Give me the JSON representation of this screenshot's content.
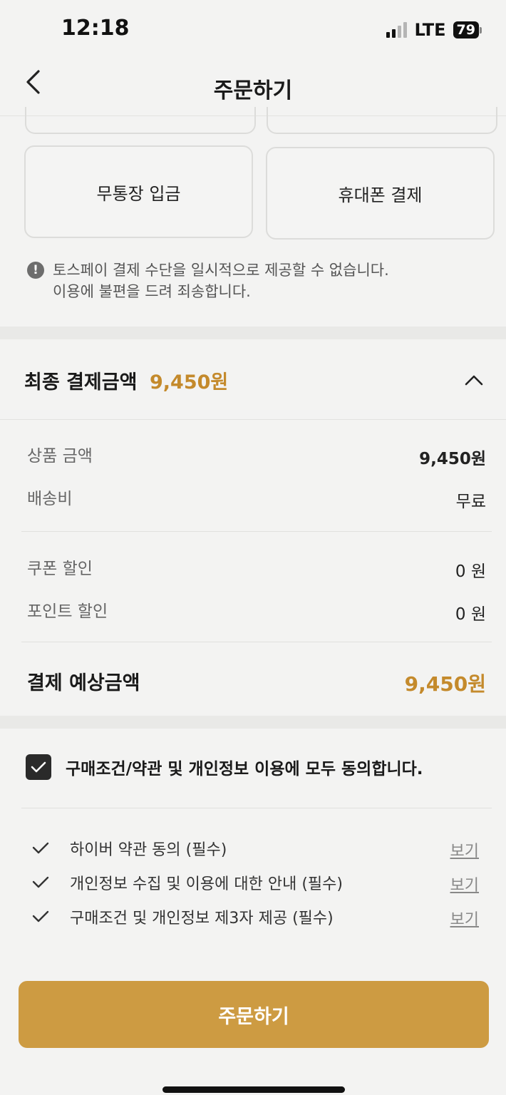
{
  "status_bar": {
    "time": "12:18",
    "network": "LTE",
    "battery": "79"
  },
  "nav": {
    "title": "주문하기"
  },
  "payment_methods": [
    {
      "label": "무통장 입금"
    },
    {
      "label": "휴대폰 결제"
    }
  ],
  "notice": {
    "line1": "토스페이 결제 수단을 일시적으로 제공할 수 없습니다.",
    "line2": "이용에 불편을 드려 죄송합니다.",
    "icon": "exclamation-circle-icon"
  },
  "final_payment": {
    "label": "최종 결제금액",
    "amount": "9,450원"
  },
  "breakdown": {
    "product": {
      "label": "상품 금액",
      "value": "9,450원"
    },
    "shipping": {
      "label": "배송비",
      "value": "무료"
    },
    "coupon": {
      "label": "쿠폰 할인",
      "value": "0 원"
    },
    "point": {
      "label": "포인트 할인",
      "value": "0 원"
    }
  },
  "expected": {
    "label": "결제 예상금액",
    "amount": "9,450원"
  },
  "agree_all": {
    "label": "구매조건/약관 및 개인정보 이용에 모두 동의합니다.",
    "checked": true
  },
  "terms": [
    {
      "label": "하이버 약관 동의 (필수)",
      "link": "보기"
    },
    {
      "label": "개인정보 수집 및 이용에 대한 안내 (필수)",
      "link": "보기"
    },
    {
      "label": "구매조건 및 개인정보 제3자 제공 (필수)",
      "link": "보기"
    }
  ],
  "order_button": {
    "label": "주문하기"
  },
  "colors": {
    "accent": "#c48a2c",
    "button": "#cd9b42"
  }
}
